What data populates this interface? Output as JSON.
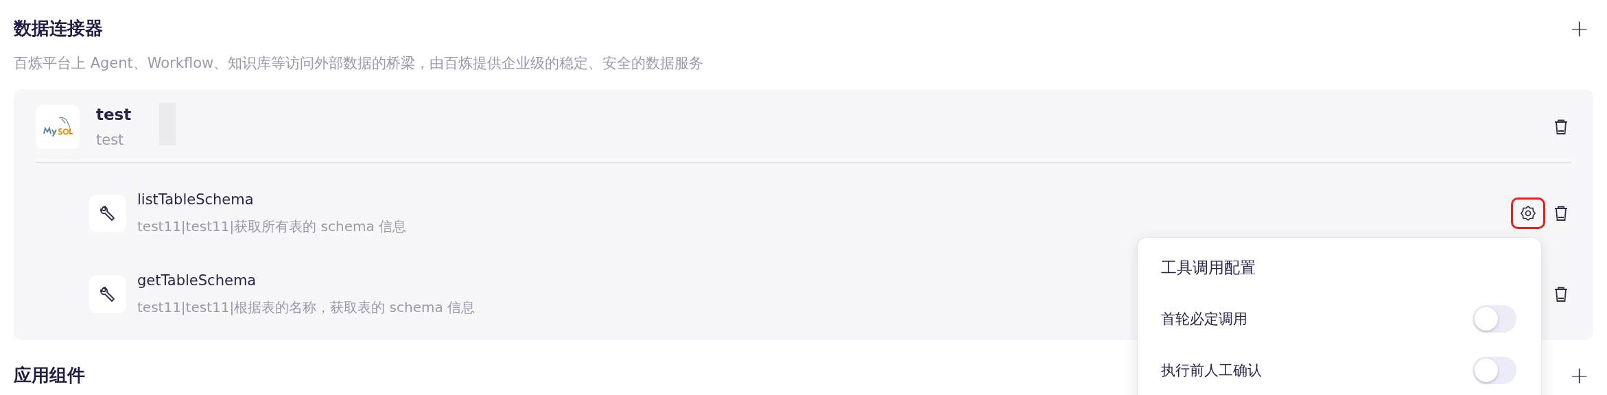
{
  "section": {
    "title": "数据连接器",
    "add_icon": "+",
    "description": "百炼平台上 Agent、Workflow、知识库等访问外部数据的桥梁，由百炼提供企业级的稳定、安全的数据服务"
  },
  "connector": {
    "name": "test",
    "subtitle": "test",
    "redacted": true,
    "tools": [
      {
        "name": "listTableSchema",
        "description": "test11|test11|获取所有表的 schema 信息",
        "settings": {
          "highlighted": true
        }
      },
      {
        "name": "getTableSchema",
        "description": "test11|test11|根据表的名称，获取表的 schema 信息"
      }
    ]
  },
  "popover": {
    "title": "工具调用配置",
    "options": [
      {
        "label": "首轮必定调用",
        "on": false
      },
      {
        "label": "执行前人工确认",
        "on": false
      }
    ]
  },
  "next_section": {
    "title": "应用组件",
    "add_icon": "+"
  }
}
